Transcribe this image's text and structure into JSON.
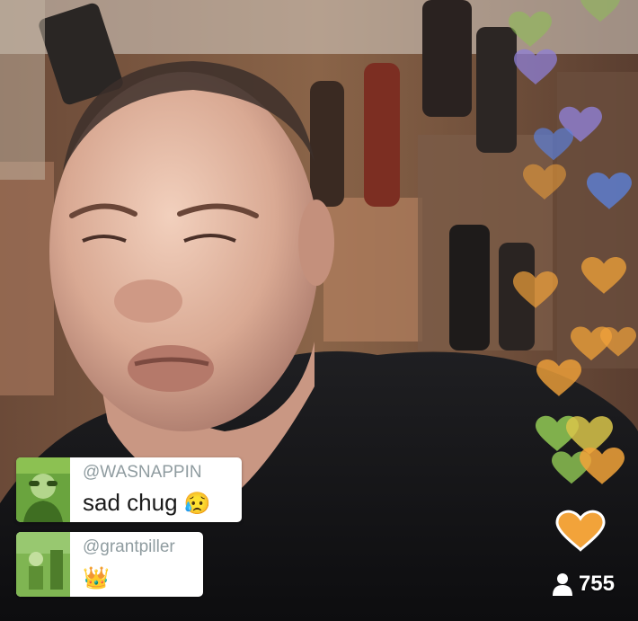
{
  "stream": {
    "video_description_icon": "live-video-icon"
  },
  "comments": [
    {
      "handle": "@WASNAPPIN",
      "text": "sad chug",
      "emoji": "😥",
      "avatar_icon": "avatar-icon"
    },
    {
      "handle": "@grantpiller",
      "text": "",
      "emoji": "👑",
      "avatar_icon": "avatar-icon"
    }
  ],
  "viewers": {
    "count": "755",
    "icon": "person-icon"
  },
  "heart_colors": {
    "green": "#8cc152",
    "purple": "#8e7fd6",
    "blue": "#5b7fd8",
    "orange": "#f2a33a",
    "yellow": "#d9c64a"
  }
}
